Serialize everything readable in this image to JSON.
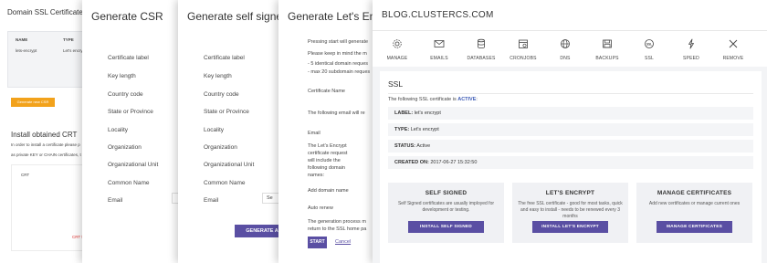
{
  "panel1": {
    "title": "Domain SSL Certificates",
    "col_name": "NAME",
    "col_type": "TYPE",
    "row_name": "lets-encrypt",
    "row_type": "Let's encrypt",
    "new_csr_button": "Generate new CSR",
    "install_title": "Install obtained CRT",
    "install_desc1": "In order to install a certificate please p",
    "install_desc2": "as private KEY or CHAIN certificates, t",
    "crt_label": "CRT",
    "crt_red": "CRT fie"
  },
  "panel2": {
    "title": "Generate CSR",
    "fields": [
      "Certificate label",
      "Key length",
      "Country code",
      "State or Province",
      "Locality",
      "Organization",
      "Organizational Unit",
      "Common Name",
      "Email"
    ]
  },
  "panel3": {
    "title": "Generate self signed c",
    "fields": [
      "Certificate label",
      "Key length",
      "Country code",
      "State or Province",
      "Locality",
      "Organization",
      "Organizational Unit",
      "Common Name",
      "Email"
    ],
    "email_value": "Se",
    "generate_button": "GENERATE A"
  },
  "panel4": {
    "title": "Generate Let's Encrypt",
    "intro1": "Pressing start will generate",
    "intro2": "Please keep in mind the m",
    "limit1": "- 5 identical domain reques",
    "limit2": "- max 20 subdomain reques",
    "cert_name_label": "Certificate Name",
    "email_note": "The following email will re",
    "email_label": "Email",
    "include_note": [
      "The Let's Encrypt",
      "certificate request",
      "will include the",
      "following domain",
      "names:"
    ],
    "add_domain_label": "Add domain name",
    "auto_renew_label": "Auto renew",
    "generation_note1": "The generation process m",
    "generation_note2": "return to the SSL home pa",
    "start_button": "START",
    "cancel_link": "Cancel"
  },
  "main": {
    "domain_title": "BLOG.CLUSTERCS.COM",
    "nav": [
      {
        "label": "MANAGE",
        "icon": "gear-icon"
      },
      {
        "label": "EMAILS",
        "icon": "envelope-icon"
      },
      {
        "label": "DATABASES",
        "icon": "database-icon"
      },
      {
        "label": "CRONJOBS",
        "icon": "calendar-icon"
      },
      {
        "label": "DNS",
        "icon": "globe-icon"
      },
      {
        "label": "BACKUPS",
        "icon": "backup-icon"
      },
      {
        "label": "SSL",
        "icon": "ssl-icon"
      },
      {
        "label": "SPEED",
        "icon": "bolt-icon"
      },
      {
        "label": "REMOVE",
        "icon": "close-icon"
      }
    ],
    "section_title": "SSL",
    "status_prefix": "The following SSL certificate is ",
    "status_active": "ACTIVE",
    "status_suffix": ":",
    "label_key": "LABEL:",
    "label_value": "let's encrypt",
    "type_key": "TYPE:",
    "type_value": "Let's encrypt",
    "status_key": "STATUS:",
    "status_value": "Active",
    "created_key": "CREATED ON:",
    "created_value": "2017-06-27 15:32:50",
    "cards": [
      {
        "title": "SELF SIGNED",
        "desc": "Self Signed certificates are usually imployed for development or testing.",
        "button": "INSTALL SELF SIGNED"
      },
      {
        "title": "LET'S ENCRYPT",
        "desc": "The free SSL certificate - good for most tasks, quick and easy to install - needs to be renewed every 3 months",
        "button": "INSTALL LET'S ENCRYPT"
      },
      {
        "title": "MANAGE CERTIFICATES",
        "desc": "Add new certificates or manage current ones",
        "button": "MANAGE CERTIFICATES"
      }
    ],
    "colors": {
      "accent": "#5a4fa3",
      "orange": "#f2a21b",
      "active": "#3d5bb5"
    }
  }
}
